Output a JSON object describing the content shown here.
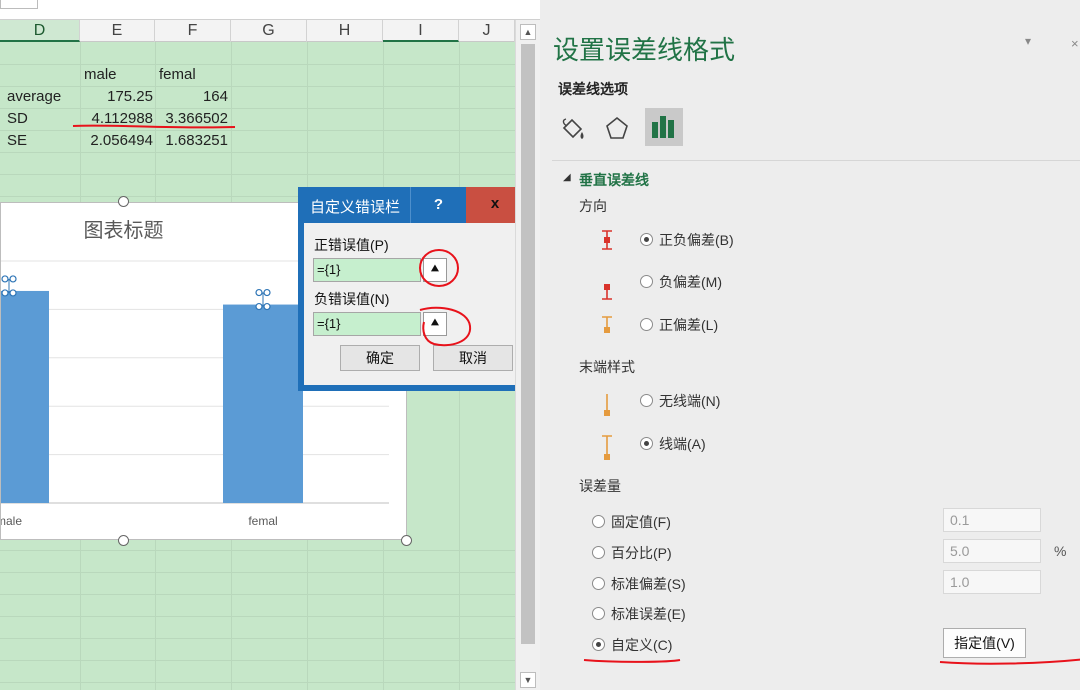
{
  "sheet": {
    "columns": [
      "D",
      "E",
      "F",
      "G",
      "H",
      "I",
      "J"
    ],
    "rows": [
      {
        "label": "",
        "e": "male",
        "f": "femal"
      },
      {
        "label": "average",
        "e": "175.25",
        "f": "164"
      },
      {
        "label": "SD",
        "e": "4.112988",
        "f": "3.366502"
      },
      {
        "label": "SE",
        "e": "2.056494",
        "f": "1.683251"
      }
    ]
  },
  "chart": {
    "title": "图表标题",
    "chart_data": {
      "type": "bar",
      "categories": [
        "male",
        "femal"
      ],
      "values": [
        175.25,
        164
      ],
      "title": "图表标题",
      "xlabel": "",
      "ylabel": ""
    }
  },
  "dialog": {
    "title": "自定义错误栏",
    "help_label": "?",
    "close_label": "x",
    "positive_label": "正错误值(P)",
    "positive_value": "={1}",
    "negative_label": "负错误值(N)",
    "negative_value": "={1}",
    "ok_label": "确定",
    "cancel_label": "取消"
  },
  "panel": {
    "title": "设置误差线格式",
    "subtitle": "误差线选项",
    "section": "垂直误差线",
    "direction_label": "方向",
    "direction_options": [
      "正负偏差(B)",
      "负偏差(M)",
      "正偏差(L)"
    ],
    "end_style_label": "末端样式",
    "end_style_options": [
      "无线端(N)",
      "线端(A)"
    ],
    "amount_label": "误差量",
    "amount_options": [
      "固定值(F)",
      "百分比(P)",
      "标准偏差(S)",
      "标准误差(E)",
      "自定义(C)"
    ],
    "fixed_value": "0.1",
    "percent_value": "5.0",
    "percent_unit": "%",
    "stdev_value": "1.0",
    "specify_button": "指定值(V)",
    "accent_color": "#217346"
  }
}
